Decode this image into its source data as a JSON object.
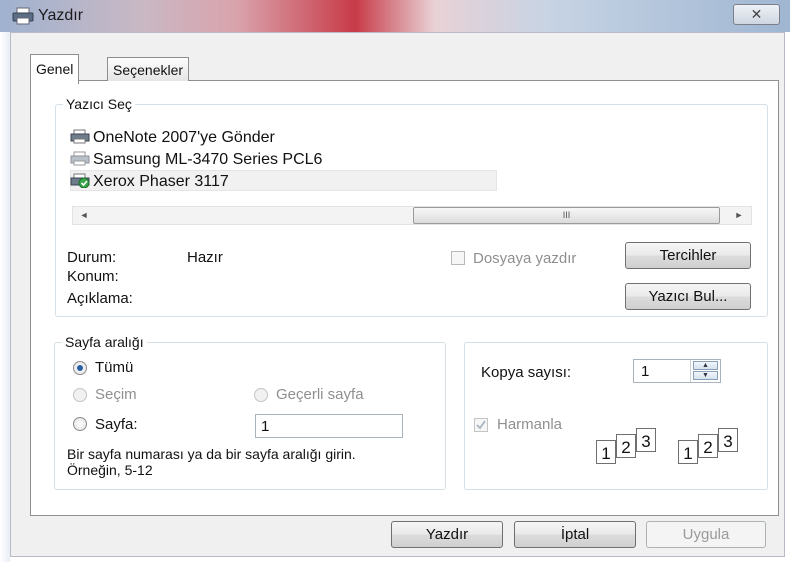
{
  "window": {
    "title": "Yazdır",
    "close_label": "✕"
  },
  "tabs": [
    {
      "label": "Genel",
      "active": true
    },
    {
      "label": "Seçenekler",
      "active": false
    }
  ],
  "printer_section": {
    "legend": "Yazıcı Seç",
    "printers": [
      {
        "name": "OneNote 2007'ye Gönder",
        "selected": false
      },
      {
        "name": "Samsung ML-3470 Series PCL6",
        "selected": false
      },
      {
        "name": "Xerox Phaser 3117",
        "selected": true,
        "default": true
      }
    ],
    "scrollbar": {
      "left_arrow": "◄",
      "right_arrow": "►",
      "thumb_grip": "III"
    },
    "status_label": "Durum:",
    "status_value": "Hazır",
    "location_label": "Konum:",
    "comment_label": "Açıklama:",
    "print_to_file_label": "Dosyaya yazdır",
    "print_to_file_checked": false,
    "preferences_button": "Tercihler",
    "find_printer_button": "Yazıcı Bul..."
  },
  "page_range": {
    "legend": "Sayfa aralığı",
    "all_label": "Tümü",
    "selection_label": "Seçim",
    "current_page_label": "Geçerli sayfa",
    "pages_label": "Sayfa:",
    "pages_value": "1",
    "hint": "Bir sayfa numarası ya da bir sayfa aralığı girin.  Örneğin, 5-12",
    "selected": "all"
  },
  "copies": {
    "label": "Kopya sayısı:",
    "value": "1",
    "collate_label": "Harmanla",
    "collate_checked": true,
    "spin_up": "▲",
    "spin_down": "▼",
    "collate_pages": [
      "1",
      "2",
      "3"
    ]
  },
  "buttons": {
    "print": "Yazdır",
    "cancel": "İptal",
    "apply": "Uygula"
  },
  "colors": {
    "accent_blue": "#2c5ea8",
    "default_check_green": "#3aa64a",
    "disabled_text": "#8f8f8f"
  }
}
